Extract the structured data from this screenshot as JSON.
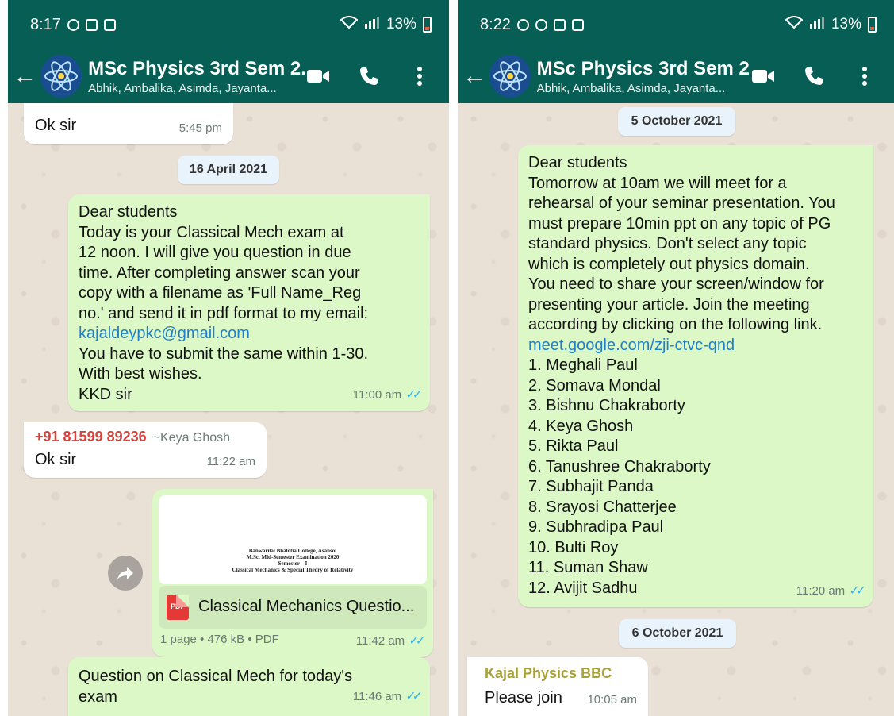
{
  "left": {
    "status": {
      "time": "8:17",
      "battery": "13%"
    },
    "header": {
      "title": "MSc Physics 3rd Sem 2...",
      "subtitle": "Abhik, Ambalika, Asimda, Jayanta..."
    },
    "messages": {
      "m1": {
        "text": "Ok sir",
        "time": "5:45 pm"
      },
      "date1": "16 April 2021",
      "m2": {
        "line1": "Dear students",
        "line2": "Today is your Classical Mech exam at",
        "line3": "12 noon. I will give you question in due",
        "line4": "time. After completing answer scan your",
        "line5": "copy with a filename as 'Full Name_Reg",
        "line6": "no.' and send it in pdf format to my email:",
        "email": "kajaldeypkc@gmail.com",
        "line7": "You have to submit the same within 1-30.",
        "line8": "With best wishes.",
        "line9": "KKD sir",
        "time": "11:00 am"
      },
      "m3": {
        "sender": "+91 81599 89236",
        "pushname": "~Keya Ghosh",
        "text": "Ok sir",
        "time": "11:22 am"
      },
      "m4": {
        "preview_line1": "Banwarilal Bhalotia College, Asansol",
        "preview_line2": "M.Sc. Mid-Semester Examination 2020",
        "preview_line3": "Semester – I",
        "preview_line4": "Classical Mechanics & Special Theory of Relativity",
        "pdf_label": "PDF",
        "doc_name": "Classical Mechanics Questio...",
        "doc_info": "1 page • 476 kB • PDF",
        "time": "11:42 am"
      },
      "m5": {
        "line1": "Question on Classical Mech for today's",
        "line2": "exam",
        "time": "11:46 am"
      }
    }
  },
  "right": {
    "status": {
      "time": "8:22",
      "battery": "13%"
    },
    "header": {
      "title": "MSc Physics 3rd Sem 2...",
      "subtitle": "Abhik, Ambalika, Asimda, Jayanta..."
    },
    "messages": {
      "date1": "5 October 2021",
      "m1": {
        "line1": "Dear students",
        "line2": "Tomorrow at 10am we will meet for a",
        "line3": "rehearsal of your seminar presentation. You",
        "line4": "must prepare 10min ppt on any topic of PG",
        "line5": "standard physics. Don't select any topic",
        "line6": "which is completely out physics domain.",
        "line7": "You need to share your screen/window for",
        "line8": "presenting your article. Join the meeting",
        "line9": "according by clicking on the following link.",
        "link": "meet.google.com/zji-ctvc-qnd",
        "names": [
          "1. Meghali Paul",
          "2. Somava Mondal",
          "3. Bishnu Chakraborty",
          "4. Keya Ghosh",
          "5. Rikta Paul",
          "6. Tanushree Chakraborty",
          "7. Subhajit Panda",
          "8. Srayosi Chatterjee",
          "9. Subhradipa Paul",
          "10. Bulti Roy",
          "11. Suman Shaw",
          "12. Avijit Sadhu"
        ],
        "time": "11:20 am"
      },
      "date2": "6 October 2021",
      "m2": {
        "sender": "Kajal Physics BBC",
        "text": "Please join",
        "time": "10:05 am"
      }
    }
  },
  "colors": {
    "header": "#075e54",
    "outgoing": "#dcf8c6",
    "incoming": "#ffffff",
    "link": "#1f7fc9",
    "ticks": "#34b7f1"
  }
}
